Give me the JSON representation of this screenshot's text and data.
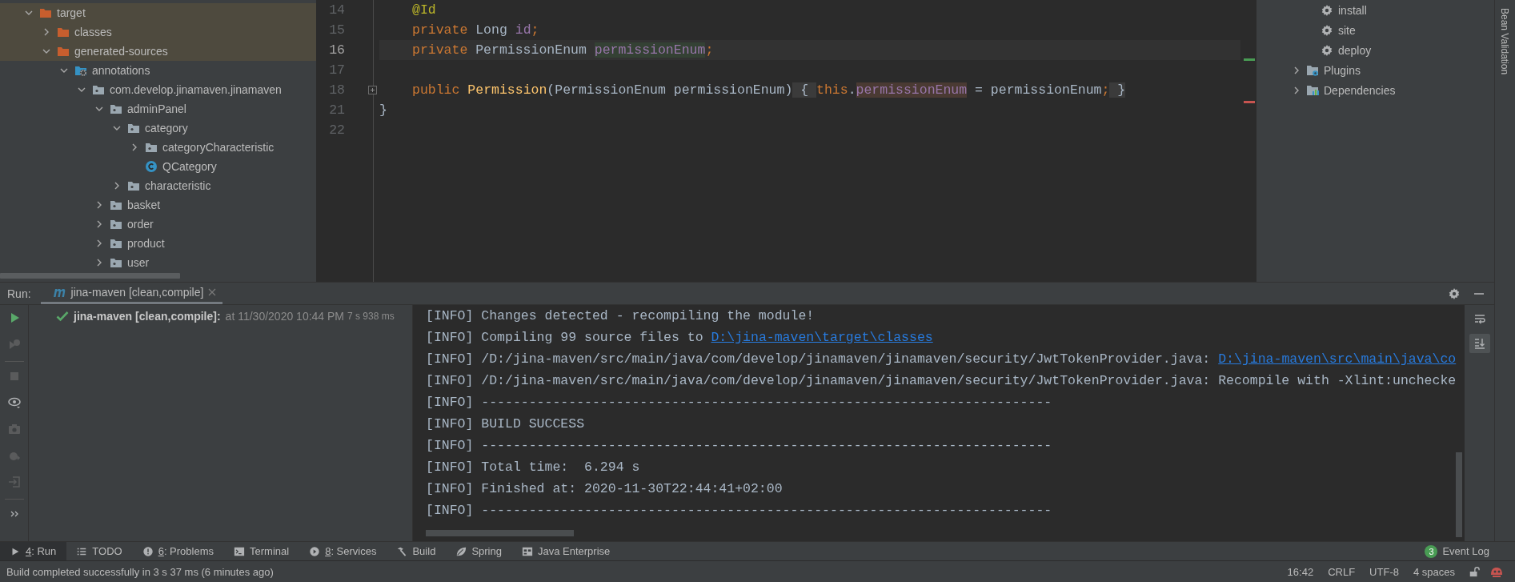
{
  "project_tree": {
    "items": [
      {
        "label": "target",
        "kind": "output-folder",
        "expanded": true,
        "highlighted": true,
        "children": [
          {
            "label": "classes",
            "kind": "output-folder",
            "expanded": false,
            "highlighted": true
          },
          {
            "label": "generated-sources",
            "kind": "output-folder",
            "expanded": true,
            "highlighted": true,
            "children": [
              {
                "label": "annotations",
                "kind": "generated-root",
                "expanded": true,
                "highlighted": false,
                "children": [
                  {
                    "label": "com.develop.jinamaven.jinamaven",
                    "kind": "package",
                    "expanded": true,
                    "highlighted": false,
                    "children": [
                      {
                        "label": "adminPanel",
                        "kind": "package",
                        "expanded": true,
                        "highlighted": false,
                        "children": [
                          {
                            "label": "category",
                            "kind": "package",
                            "expanded": true,
                            "highlighted": false,
                            "children": [
                              {
                                "label": "categoryCharacteristic",
                                "kind": "package",
                                "expanded": false,
                                "highlighted": false
                              },
                              {
                                "label": "QCategory",
                                "kind": "class",
                                "highlighted": false
                              }
                            ]
                          },
                          {
                            "label": "characteristic",
                            "kind": "package",
                            "expanded": false,
                            "highlighted": false
                          }
                        ]
                      },
                      {
                        "label": "basket",
                        "kind": "package",
                        "expanded": false,
                        "highlighted": false
                      },
                      {
                        "label": "order",
                        "kind": "package",
                        "expanded": false,
                        "highlighted": false
                      },
                      {
                        "label": "product",
                        "kind": "package",
                        "expanded": false,
                        "highlighted": false
                      },
                      {
                        "label": "user",
                        "kind": "package",
                        "expanded": false,
                        "highlighted": false
                      }
                    ]
                  }
                ]
              }
            ]
          }
        ]
      }
    ]
  },
  "editor": {
    "lines": [
      {
        "number": "14",
        "indented": true,
        "current": false,
        "folded": false,
        "tokens": [
          {
            "text": "@Id",
            "kind": "annotation"
          }
        ]
      },
      {
        "number": "15",
        "indented": true,
        "current": false,
        "folded": false,
        "tokens": [
          {
            "text": "private",
            "kind": "keyword"
          },
          {
            "text": " Long ",
            "kind": "plain"
          },
          {
            "text": "id",
            "kind": "field"
          },
          {
            "text": ";",
            "kind": "keyword"
          }
        ]
      },
      {
        "number": "16",
        "indented": true,
        "current": true,
        "folded": false,
        "tokens": [
          {
            "text": "private",
            "kind": "keyword"
          },
          {
            "text": " PermissionEnum ",
            "kind": "plain"
          },
          {
            "text": "permissionEnum",
            "kind": "field-declaration"
          },
          {
            "text": ";",
            "kind": "keyword"
          }
        ]
      },
      {
        "number": "17",
        "current": false,
        "folded": false
      },
      {
        "number": "18",
        "indented": true,
        "current": false,
        "folded": true,
        "tokens": [
          {
            "text": "public",
            "kind": "keyword"
          },
          {
            "text": " Permission",
            "kind": "method"
          },
          {
            "text": "(PermissionEnum permissionEnum)",
            "kind": "plain"
          },
          {
            "text": " { ",
            "kind": "fold-placeholder"
          },
          {
            "text": "this",
            "kind": "keyword"
          },
          {
            "text": ".",
            "kind": "plain"
          },
          {
            "text": "permissionEnum",
            "kind": "field-write"
          },
          {
            "text": " = permissionEnum",
            "kind": "plain"
          },
          {
            "text": ";",
            "kind": "keyword"
          },
          {
            "text": " }",
            "kind": "fold-placeholder"
          }
        ]
      },
      {
        "number": "21",
        "indented": false,
        "current": false,
        "folded": false,
        "tokens": [
          {
            "text": "}",
            "kind": "plain"
          }
        ]
      },
      {
        "number": "22",
        "current": false,
        "folded": false
      }
    ]
  },
  "maven_panel": {
    "items": [
      {
        "label": "install",
        "kind": "goal"
      },
      {
        "label": "site",
        "kind": "goal"
      },
      {
        "label": "deploy",
        "kind": "goal"
      },
      {
        "label": "Plugins",
        "kind": "plugins",
        "expanded": false
      },
      {
        "label": "Dependencies",
        "kind": "dependencies",
        "expanded": false
      }
    ]
  },
  "right_stripe": {
    "label": "Bean Validation"
  },
  "run_panel": {
    "label": "Run:",
    "tabs": [
      {
        "label": "jina-maven [clean,compile]",
        "selected": true
      }
    ],
    "toolbar": [
      {
        "kind": "rerun",
        "disabled": false
      },
      {
        "kind": "rerun-failed",
        "disabled": true
      },
      {
        "kind": "stop",
        "disabled": true
      },
      {
        "kind": "view",
        "disabled": false
      },
      {
        "kind": "screenshot",
        "disabled": true
      },
      {
        "kind": "export",
        "disabled": true
      },
      {
        "kind": "import",
        "disabled": true
      },
      {
        "kind": "more",
        "disabled": false
      }
    ],
    "tree": [
      {
        "succeeded": true,
        "name": "jina-maven [clean,compile]:",
        "time": "at 11/30/2020 10:44 PM",
        "duration": "7 s 938 ms"
      }
    ],
    "console": [
      [
        {
          "text": "[INFO] Changes detected - recompiling the module!",
          "kind": "text"
        }
      ],
      [
        {
          "text": "[INFO] Compiling 99 source files to ",
          "kind": "text"
        },
        {
          "text": "D:\\jina-maven\\target\\classes",
          "kind": "link"
        }
      ],
      [
        {
          "text": "[INFO] /D:/jina-maven/src/main/java/com/develop/jinamaven/jinamaven/security/JwtTokenProvider.java: ",
          "kind": "text"
        },
        {
          "text": "D:\\jina-maven\\src\\main\\java\\co",
          "kind": "link"
        }
      ],
      [
        {
          "text": "[INFO] /D:/jina-maven/src/main/java/com/develop/jinamaven/jinamaven/security/JwtTokenProvider.java: Recompile with -Xlint:unchecke",
          "kind": "text"
        }
      ],
      [
        {
          "text": "[INFO] ------------------------------------------------------------------------",
          "kind": "text"
        }
      ],
      [
        {
          "text": "[INFO] BUILD SUCCESS",
          "kind": "text"
        }
      ],
      [
        {
          "text": "[INFO] ------------------------------------------------------------------------",
          "kind": "text"
        }
      ],
      [
        {
          "text": "[INFO] Total time:  6.294 s",
          "kind": "text"
        }
      ],
      [
        {
          "text": "[INFO] Finished at: 2020-11-30T22:44:41+02:00",
          "kind": "text"
        }
      ],
      [
        {
          "text": "[INFO] ------------------------------------------------------------------------",
          "kind": "text"
        }
      ]
    ],
    "side_actions": [
      {
        "kind": "soft-wrap",
        "selected": false
      },
      {
        "kind": "scroll-to-end",
        "selected": true
      }
    ]
  },
  "bottom_toolbar": {
    "tools": [
      {
        "kind": "run",
        "mnemonic": "4",
        "label": ": Run",
        "selected": true
      },
      {
        "kind": "todo",
        "label": "TODO",
        "selected": false
      },
      {
        "kind": "problems",
        "mnemonic": "6",
        "label": ": Problems",
        "selected": false
      },
      {
        "kind": "terminal",
        "label": "Terminal",
        "selected": false
      },
      {
        "kind": "services",
        "mnemonic": "8",
        "label": ": Services",
        "selected": false
      },
      {
        "kind": "build",
        "label": "Build",
        "selected": false
      },
      {
        "kind": "spring",
        "label": "Spring",
        "selected": false
      },
      {
        "kind": "enterprise",
        "label": "Java Enterprise",
        "selected": false
      }
    ],
    "event_log": {
      "count": "3",
      "label": "Event Log"
    }
  },
  "status_bar": {
    "message": "Build completed successfully in 3 s 37 ms (6 minutes ago)",
    "items": [
      "16:42",
      "CRLF",
      "UTF-8",
      "4 spaces"
    ]
  }
}
